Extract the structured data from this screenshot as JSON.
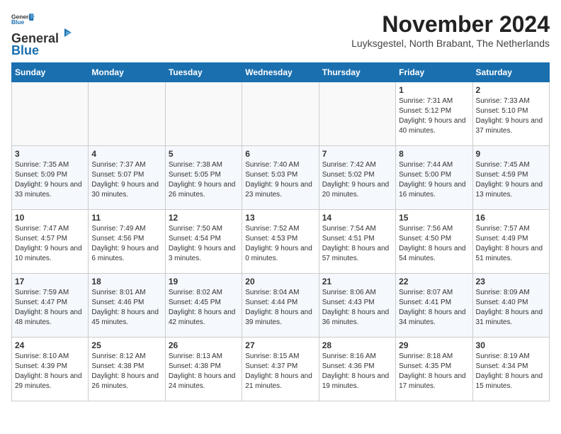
{
  "logo": {
    "line1": "General",
    "line2": "Blue"
  },
  "title": "November 2024",
  "location": "Luyksgestel, North Brabant, The Netherlands",
  "days_of_week": [
    "Sunday",
    "Monday",
    "Tuesday",
    "Wednesday",
    "Thursday",
    "Friday",
    "Saturday"
  ],
  "weeks": [
    [
      {
        "day": "",
        "info": ""
      },
      {
        "day": "",
        "info": ""
      },
      {
        "day": "",
        "info": ""
      },
      {
        "day": "",
        "info": ""
      },
      {
        "day": "",
        "info": ""
      },
      {
        "day": "1",
        "info": "Sunrise: 7:31 AM\nSunset: 5:12 PM\nDaylight: 9 hours and 40 minutes."
      },
      {
        "day": "2",
        "info": "Sunrise: 7:33 AM\nSunset: 5:10 PM\nDaylight: 9 hours and 37 minutes."
      }
    ],
    [
      {
        "day": "3",
        "info": "Sunrise: 7:35 AM\nSunset: 5:09 PM\nDaylight: 9 hours and 33 minutes."
      },
      {
        "day": "4",
        "info": "Sunrise: 7:37 AM\nSunset: 5:07 PM\nDaylight: 9 hours and 30 minutes."
      },
      {
        "day": "5",
        "info": "Sunrise: 7:38 AM\nSunset: 5:05 PM\nDaylight: 9 hours and 26 minutes."
      },
      {
        "day": "6",
        "info": "Sunrise: 7:40 AM\nSunset: 5:03 PM\nDaylight: 9 hours and 23 minutes."
      },
      {
        "day": "7",
        "info": "Sunrise: 7:42 AM\nSunset: 5:02 PM\nDaylight: 9 hours and 20 minutes."
      },
      {
        "day": "8",
        "info": "Sunrise: 7:44 AM\nSunset: 5:00 PM\nDaylight: 9 hours and 16 minutes."
      },
      {
        "day": "9",
        "info": "Sunrise: 7:45 AM\nSunset: 4:59 PM\nDaylight: 9 hours and 13 minutes."
      }
    ],
    [
      {
        "day": "10",
        "info": "Sunrise: 7:47 AM\nSunset: 4:57 PM\nDaylight: 9 hours and 10 minutes."
      },
      {
        "day": "11",
        "info": "Sunrise: 7:49 AM\nSunset: 4:56 PM\nDaylight: 9 hours and 6 minutes."
      },
      {
        "day": "12",
        "info": "Sunrise: 7:50 AM\nSunset: 4:54 PM\nDaylight: 9 hours and 3 minutes."
      },
      {
        "day": "13",
        "info": "Sunrise: 7:52 AM\nSunset: 4:53 PM\nDaylight: 9 hours and 0 minutes."
      },
      {
        "day": "14",
        "info": "Sunrise: 7:54 AM\nSunset: 4:51 PM\nDaylight: 8 hours and 57 minutes."
      },
      {
        "day": "15",
        "info": "Sunrise: 7:56 AM\nSunset: 4:50 PM\nDaylight: 8 hours and 54 minutes."
      },
      {
        "day": "16",
        "info": "Sunrise: 7:57 AM\nSunset: 4:49 PM\nDaylight: 8 hours and 51 minutes."
      }
    ],
    [
      {
        "day": "17",
        "info": "Sunrise: 7:59 AM\nSunset: 4:47 PM\nDaylight: 8 hours and 48 minutes."
      },
      {
        "day": "18",
        "info": "Sunrise: 8:01 AM\nSunset: 4:46 PM\nDaylight: 8 hours and 45 minutes."
      },
      {
        "day": "19",
        "info": "Sunrise: 8:02 AM\nSunset: 4:45 PM\nDaylight: 8 hours and 42 minutes."
      },
      {
        "day": "20",
        "info": "Sunrise: 8:04 AM\nSunset: 4:44 PM\nDaylight: 8 hours and 39 minutes."
      },
      {
        "day": "21",
        "info": "Sunrise: 8:06 AM\nSunset: 4:43 PM\nDaylight: 8 hours and 36 minutes."
      },
      {
        "day": "22",
        "info": "Sunrise: 8:07 AM\nSunset: 4:41 PM\nDaylight: 8 hours and 34 minutes."
      },
      {
        "day": "23",
        "info": "Sunrise: 8:09 AM\nSunset: 4:40 PM\nDaylight: 8 hours and 31 minutes."
      }
    ],
    [
      {
        "day": "24",
        "info": "Sunrise: 8:10 AM\nSunset: 4:39 PM\nDaylight: 8 hours and 29 minutes."
      },
      {
        "day": "25",
        "info": "Sunrise: 8:12 AM\nSunset: 4:38 PM\nDaylight: 8 hours and 26 minutes."
      },
      {
        "day": "26",
        "info": "Sunrise: 8:13 AM\nSunset: 4:38 PM\nDaylight: 8 hours and 24 minutes."
      },
      {
        "day": "27",
        "info": "Sunrise: 8:15 AM\nSunset: 4:37 PM\nDaylight: 8 hours and 21 minutes."
      },
      {
        "day": "28",
        "info": "Sunrise: 8:16 AM\nSunset: 4:36 PM\nDaylight: 8 hours and 19 minutes."
      },
      {
        "day": "29",
        "info": "Sunrise: 8:18 AM\nSunset: 4:35 PM\nDaylight: 8 hours and 17 minutes."
      },
      {
        "day": "30",
        "info": "Sunrise: 8:19 AM\nSunset: 4:34 PM\nDaylight: 8 hours and 15 minutes."
      }
    ]
  ]
}
